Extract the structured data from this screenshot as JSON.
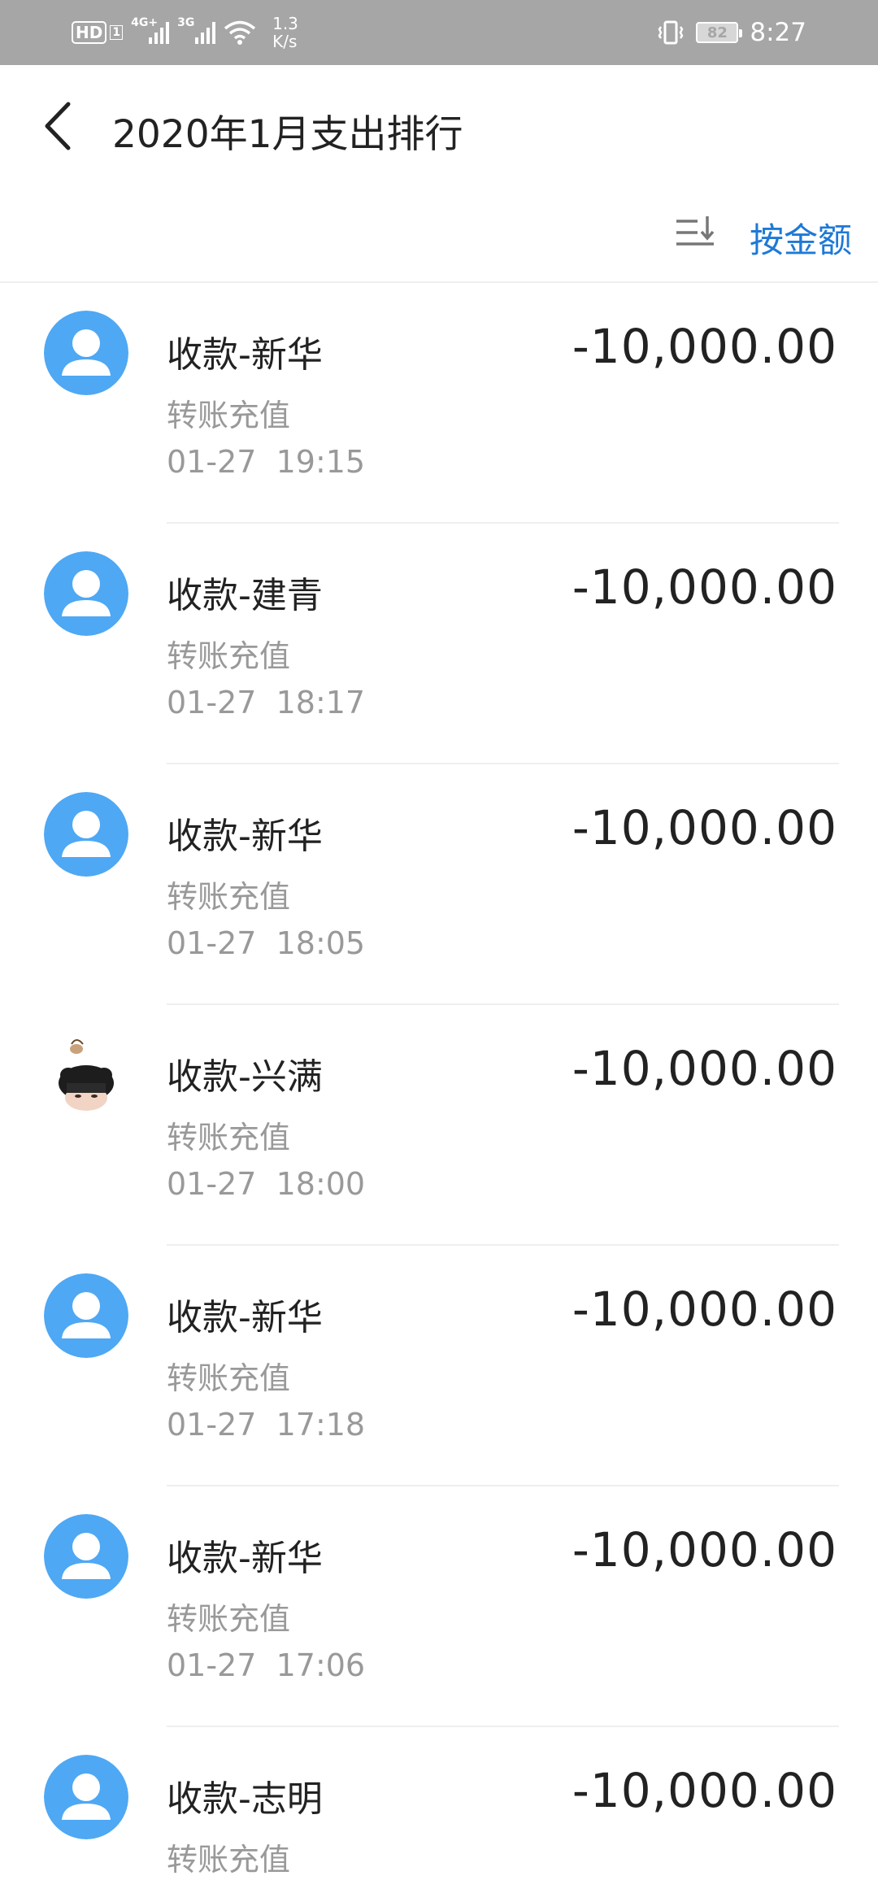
{
  "status_bar": {
    "hd": "HD",
    "sim": "1",
    "net1": "4G+",
    "net2": "3G",
    "speed_value": "1.3",
    "speed_unit": "K/s",
    "battery": "82",
    "time": "8:27"
  },
  "header": {
    "title": "2020年1月支出排行"
  },
  "sort": {
    "label": "按金额"
  },
  "colors": {
    "accent": "#1e79d6",
    "avatar_blue": "#4ea8f4",
    "status_bar": "#a6a6a6"
  },
  "items": [
    {
      "name": "收款-新华",
      "type": "转账充值",
      "date": "01-27",
      "time": "19:15",
      "amount": "-10,000.00",
      "avatar": "default-avatar"
    },
    {
      "name": "收款-建青",
      "type": "转账充值",
      "date": "01-27",
      "time": "18:17",
      "amount": "-10,000.00",
      "avatar": "default-avatar"
    },
    {
      "name": "收款-新华",
      "type": "转账充值",
      "date": "01-27",
      "time": "18:05",
      "amount": "-10,000.00",
      "avatar": "default-avatar"
    },
    {
      "name": "收款-兴满",
      "type": "转账充值",
      "date": "01-27",
      "time": "18:00",
      "amount": "-10,000.00",
      "avatar": "photo-avatar"
    },
    {
      "name": "收款-新华",
      "type": "转账充值",
      "date": "01-27",
      "time": "17:18",
      "amount": "-10,000.00",
      "avatar": "default-avatar"
    },
    {
      "name": "收款-新华",
      "type": "转账充值",
      "date": "01-27",
      "time": "17:06",
      "amount": "-10,000.00",
      "avatar": "default-avatar"
    },
    {
      "name": "收款-志明",
      "type": "转账充值",
      "date": "",
      "time": "",
      "amount": "-10,000.00",
      "avatar": "default-avatar"
    }
  ]
}
